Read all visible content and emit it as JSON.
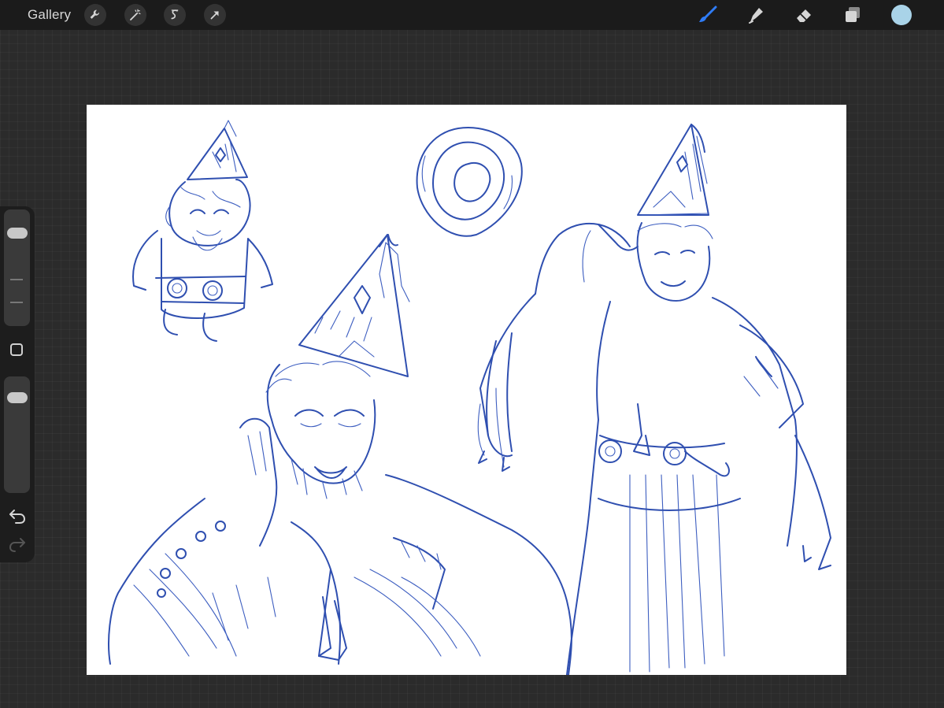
{
  "toolbar": {
    "gallery_label": "Gallery",
    "left_tools": [
      "wrench-icon",
      "magic-wand-icon",
      "selection-s-icon",
      "arrow-transform-icon"
    ],
    "right_tools": [
      "brush-icon",
      "smudge-icon",
      "eraser-icon",
      "layers-icon"
    ],
    "active_tool": "brush-icon",
    "active_tool_color": "#2f7cf6",
    "current_color": "#a9d3e8"
  },
  "sidebar": {
    "brush_size_level": 0.85,
    "opacity_level": 0.87,
    "buttons": [
      "modify-square-icon",
      "undo-icon",
      "redo-icon"
    ]
  },
  "canvas": {
    "background": "#ffffff",
    "ink_color": "#2f4fb0",
    "content": "pencil-sketch"
  }
}
